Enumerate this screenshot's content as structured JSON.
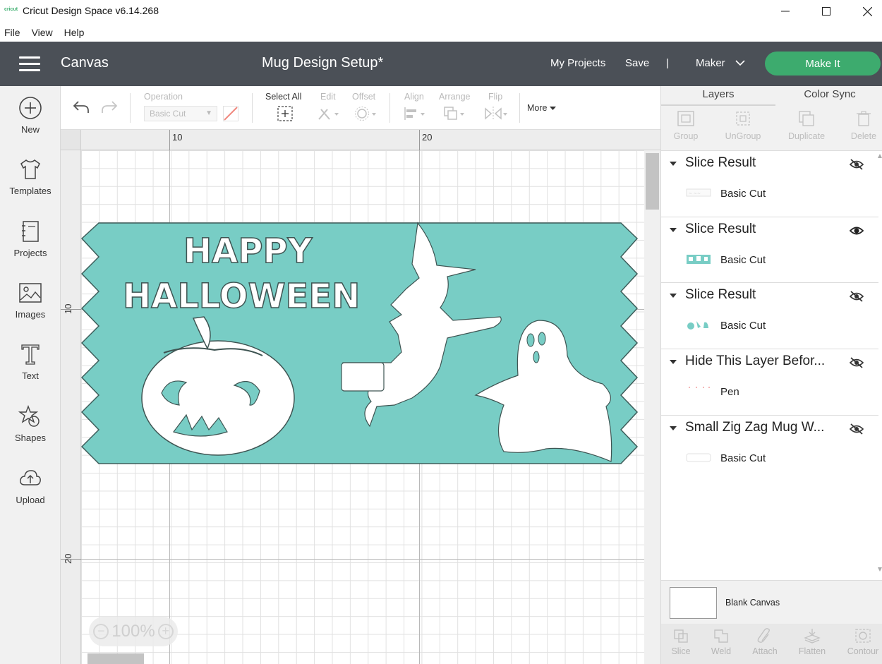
{
  "window": {
    "logo_text": "cricut",
    "title": "Cricut Design Space  v6.14.268",
    "minimize_icon": "minimize-icon",
    "maximize_icon": "maximize-icon",
    "close_icon": "close-icon"
  },
  "menu": {
    "items": [
      "File",
      "View",
      "Help"
    ]
  },
  "header": {
    "section": "Canvas",
    "project_name": "Mug Design Setup*",
    "my_projects": "My Projects",
    "save": "Save",
    "divider": "|",
    "machine": "Maker",
    "make_it": "Make It",
    "colors": {
      "bar": "#4b5057",
      "make_it": "#3dab6e"
    }
  },
  "sidebar": {
    "items": [
      {
        "label": "New",
        "icon": "plus-circle-icon"
      },
      {
        "label": "Templates",
        "icon": "tshirt-icon"
      },
      {
        "label": "Projects",
        "icon": "notebook-icon"
      },
      {
        "label": "Images",
        "icon": "image-icon"
      },
      {
        "label": "Text",
        "icon": "text-icon"
      },
      {
        "label": "Shapes",
        "icon": "shapes-icon"
      },
      {
        "label": "Upload",
        "icon": "cloud-upload-icon"
      }
    ]
  },
  "toolbar": {
    "operation_label": "Operation",
    "operation_value": "Basic Cut",
    "select_all": "Select All",
    "edit": "Edit",
    "offset": "Offset",
    "align": "Align",
    "arrange": "Arrange",
    "flip": "Flip",
    "more": "More"
  },
  "canvas": {
    "ruler_top": [
      "10",
      "20"
    ],
    "ruler_left": [
      "10",
      "20"
    ],
    "zoom_value": "100%",
    "zoom_minus": "−",
    "zoom_plus": "+",
    "design": {
      "line1": "HAPPY",
      "line2": "HALLOWEEN",
      "background_color": "#78cdc5"
    }
  },
  "layers_panel": {
    "tabs": [
      "Layers",
      "Color Sync"
    ],
    "tools": [
      "Group",
      "UnGroup",
      "Duplicate",
      "Delete"
    ],
    "layers": [
      {
        "title": "Slice Result",
        "sub": "Basic Cut",
        "visible": false
      },
      {
        "title": "Slice Result",
        "sub": "Basic Cut",
        "visible": true
      },
      {
        "title": "Slice Result",
        "sub": "Basic Cut",
        "visible": false
      },
      {
        "title": "Hide This Layer Befor...",
        "sub": "Pen",
        "visible": false
      },
      {
        "title": "Small Zig Zag Mug W...",
        "sub": "Basic Cut",
        "visible": false
      }
    ],
    "blank_canvas": "Blank Canvas",
    "bottom_tools": [
      "Slice",
      "Weld",
      "Attach",
      "Flatten",
      "Contour"
    ]
  }
}
